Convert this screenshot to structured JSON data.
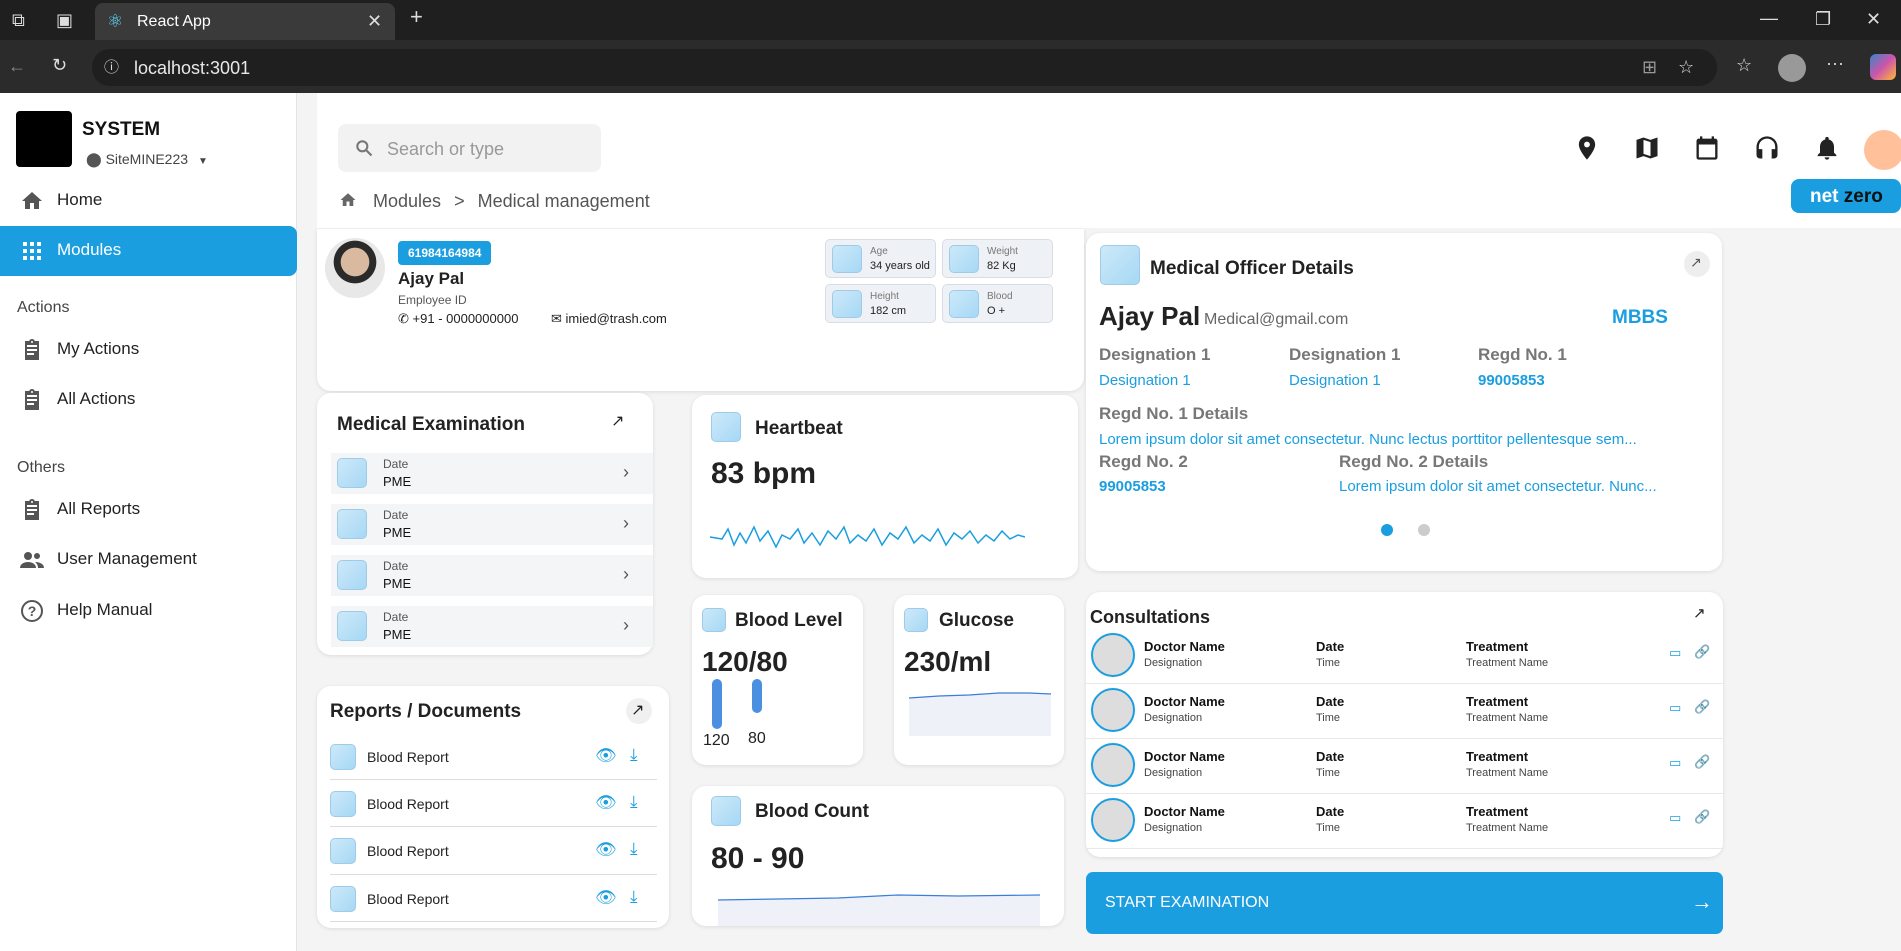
{
  "browser": {
    "tab_title": "React App",
    "url": "localhost:3001"
  },
  "sidebar": {
    "system_name": "SYSTEM",
    "site": "SiteMINE223",
    "items": [
      {
        "label": "Home"
      },
      {
        "label": "Modules"
      }
    ],
    "actions_label": "Actions",
    "actions": [
      {
        "label": "My Actions"
      },
      {
        "label": "All Actions"
      }
    ],
    "others_label": "Others",
    "others": [
      {
        "label": "All Reports"
      },
      {
        "label": "User Management"
      },
      {
        "label": "Help Manual"
      }
    ]
  },
  "header": {
    "search_placeholder": "Search or type",
    "breadcrumb": [
      "Modules",
      ">",
      "Medical management"
    ],
    "netzero_a": "net",
    "netzero_b": "zero"
  },
  "profile": {
    "id_badge": "61984164984",
    "name": "Ajay Pal",
    "employee_label": "Employee ID",
    "phone": "+91 - 0000000000",
    "email": "imied@trash.com",
    "stats": [
      {
        "k": "Age",
        "v": "34 years old"
      },
      {
        "k": "Weight",
        "v": "82 Kg"
      },
      {
        "k": "Height",
        "v": "182 cm"
      },
      {
        "k": "Blood",
        "v": "O +"
      }
    ]
  },
  "officer": {
    "title": "Medical Officer Details",
    "name": "Ajay Pal",
    "email": "Medical@gmail.com",
    "degree": "MBBS",
    "designation1_h": "Designation 1",
    "designation1_v": "Designation 1",
    "designation2_h": "Designation 1",
    "designation2_v": "Designation 1",
    "regd1_h": "Regd No. 1",
    "regd1_v": "99005853",
    "regd1_details_h": "Regd No. 1 Details",
    "regd1_details_v": "Lorem ipsum dolor sit amet consectetur. Nunc lectus porttitor pellentesque sem...",
    "regd2_h": "Regd No. 2",
    "regd2_v": "99005853",
    "regd2_details_h": "Regd No. 2 Details",
    "regd2_details_v": "Lorem ipsum dolor sit amet consectetur. Nunc..."
  },
  "exam": {
    "title": "Medical Examination",
    "rows": [
      {
        "label": "Date",
        "value": "PME"
      },
      {
        "label": "Date",
        "value": "PME"
      },
      {
        "label": "Date",
        "value": "PME"
      },
      {
        "label": "Date",
        "value": "PME"
      }
    ]
  },
  "heartbeat": {
    "title": "Heartbeat",
    "value": "83 bpm"
  },
  "blood_level": {
    "title": "Blood Level",
    "value": "120/80",
    "bar1": "120",
    "bar2": "80",
    "bar1_fill": 1.0,
    "bar2_fill": 0.67
  },
  "glucose": {
    "title": "Glucose",
    "value": "230/ml"
  },
  "blood_count": {
    "title": "Blood Count",
    "value": "80 - 90"
  },
  "reports": {
    "title": "Reports / Documents",
    "items": [
      {
        "label": "Blood Report"
      },
      {
        "label": "Blood Report"
      },
      {
        "label": "Blood Report"
      },
      {
        "label": "Blood Report"
      }
    ]
  },
  "consultations": {
    "title": "Consultations",
    "rows": [
      {
        "doctor": "Doctor Name",
        "designation": "Designation",
        "date": "Date",
        "time": "Time",
        "treatment": "Treatment",
        "treatment_name": "Treatment Name"
      },
      {
        "doctor": "Doctor Name",
        "designation": "Designation",
        "date": "Date",
        "time": "Time",
        "treatment": "Treatment",
        "treatment_name": "Treatment Name"
      },
      {
        "doctor": "Doctor Name",
        "designation": "Designation",
        "date": "Date",
        "time": "Time",
        "treatment": "Treatment",
        "treatment_name": "Treatment Name"
      },
      {
        "doctor": "Doctor Name",
        "designation": "Designation",
        "date": "Date",
        "time": "Time",
        "treatment": "Treatment",
        "treatment_name": "Treatment Name"
      }
    ]
  },
  "start_button": "START EXAMINATION"
}
